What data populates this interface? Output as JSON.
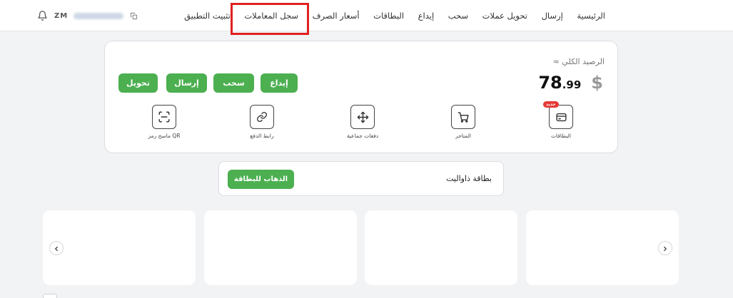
{
  "nav": {
    "items": [
      {
        "label": "الرئيسية"
      },
      {
        "label": "إرسال"
      },
      {
        "label": "تحويل عملات"
      },
      {
        "label": "سحب"
      },
      {
        "label": "إيداع"
      },
      {
        "label": "البطاقات"
      },
      {
        "label": "أسعار الصرف"
      },
      {
        "label": "سجل المعاملات"
      },
      {
        "label": "تثبيت التطبيق"
      }
    ]
  },
  "user": {
    "initials": "ZM"
  },
  "balance": {
    "label": "الرصيد الكلي ≈",
    "integer": "78",
    "decimal": ".99",
    "currency": "$"
  },
  "actions": {
    "deposit": "إيداع",
    "withdraw": "سحب",
    "send": "إرسال",
    "transfer": "تحويل"
  },
  "tiles": {
    "cards": {
      "label": "البطاقات",
      "badge": "جديد"
    },
    "stores": {
      "label": "المتاجر"
    },
    "bulk_payments": {
      "label": "دفعات جماعية"
    },
    "payment_link": {
      "label": "رابط الدفع"
    },
    "qr_scanner": {
      "label": "ماسح رمز QR"
    }
  },
  "thawallet": {
    "title": "بطاقة ذاواليت",
    "button": "الذهاب للبطاقة"
  },
  "colors": {
    "accent": "#4caf50",
    "highlight": "#e02020",
    "badge": "#e53935"
  }
}
